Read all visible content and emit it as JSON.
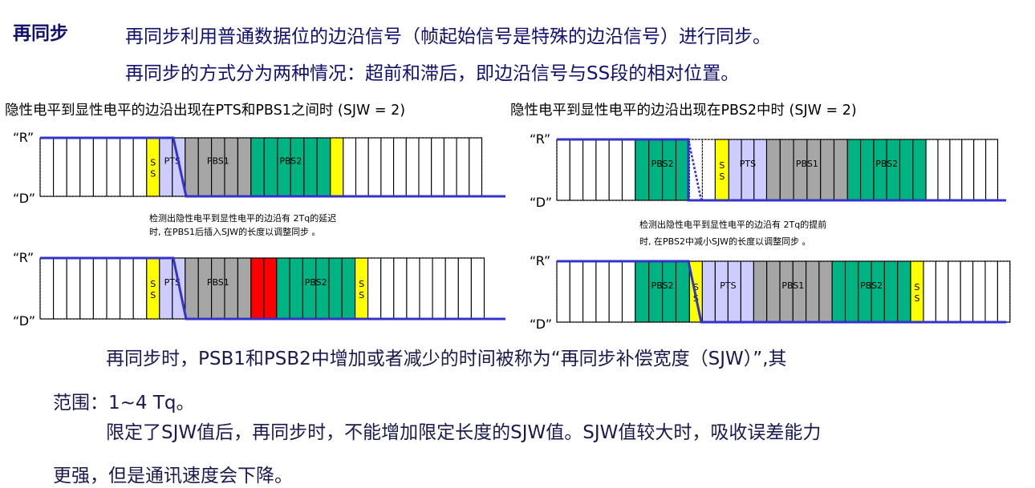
{
  "heading": {
    "section_label": "再同步",
    "line1": "再同步利用普通数据位的边沿信号（帧起始信号是特殊的边沿信号）进行同步。",
    "line2": "再同步的方式分为两种情况：超前和滞后，即边沿信号与SS段的相对位置。"
  },
  "subtitles": {
    "left": "隐性电平到显性电平的边沿出现在PTS和PBS1之间时 (SJW = 2)",
    "right": "隐性电平到显性电平的边沿出现在PBS2中时 (SJW = 2)"
  },
  "level_labels": {
    "recessive": "“R”",
    "dominant": "“D”"
  },
  "notes": {
    "left_line1": "检测出隐性电平到显性电平的边沿有  2Tq的延迟",
    "left_line2": "时, 在PBS1后插入SJW的长度以调整同步 。",
    "right_line1": "检测出隐性电平到显性电平的边沿有  2Tq的提前",
    "right_line2": "时, 在PBS2中减小SJW的长度以调整同步 。"
  },
  "segment_labels": {
    "ss_top": "S",
    "ss_bottom": "S",
    "pts": "PTS",
    "pbs1": "PBS1",
    "pbs2": "PBS2"
  },
  "colors": {
    "ss": "#ffff00",
    "pts": "#ccccff",
    "pbs1": "#a6a6a6",
    "pbs2": "#00b383",
    "sjw_insert": "#ff0000",
    "signal": "#3333cc",
    "text": "#10106e"
  },
  "body": {
    "line1": "再同步时，PSB1和PSB2中增加或者减少的时间被称为“再同步补偿宽度（SJW）”,其",
    "line2": "范围：1~4 Tq。",
    "line3": "限定了SJW值后，再同步时，不能增加限定长度的SJW值。SJW值较大时，吸收误差能力",
    "line4": "更强，但是通讯速度会下降。"
  }
}
